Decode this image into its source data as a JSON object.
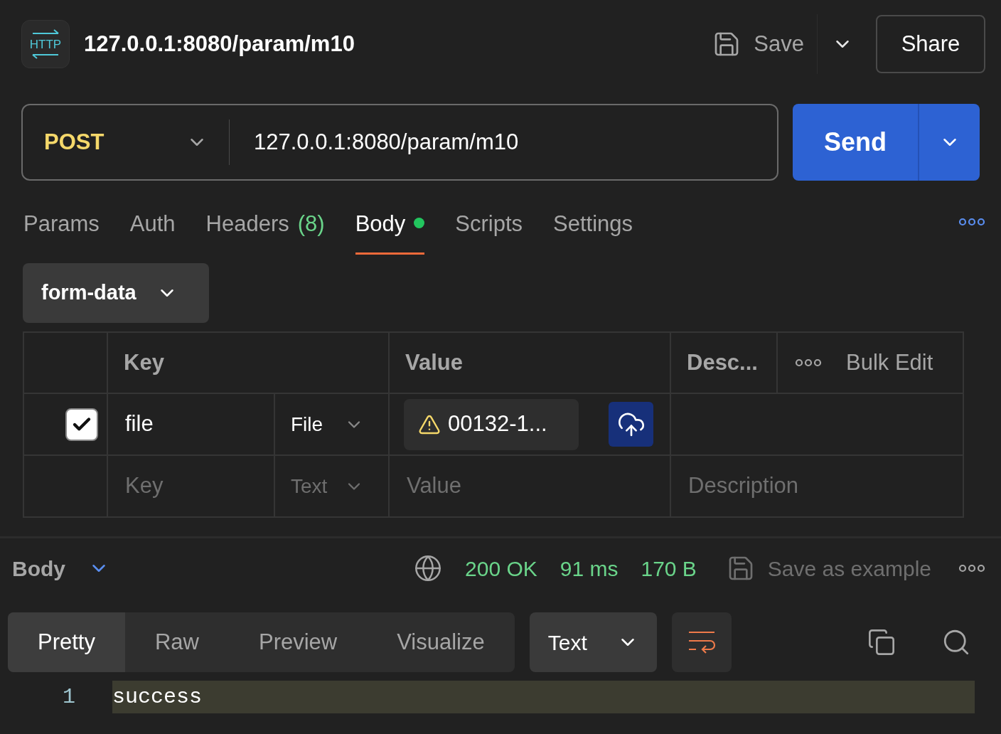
{
  "header": {
    "logo_text": "HTTP",
    "title": "127.0.0.1:8080/param/m10",
    "save_label": "Save",
    "share_label": "Share"
  },
  "request": {
    "method": "POST",
    "url": "127.0.0.1:8080/param/m10",
    "send_label": "Send"
  },
  "tabs": [
    {
      "label": "Params",
      "selected": false
    },
    {
      "label": "Auth",
      "selected": false
    },
    {
      "label": "Headers",
      "count": "(8)",
      "selected": false
    },
    {
      "label": "Body",
      "dot": true,
      "selected": true
    },
    {
      "label": "Scripts",
      "selected": false
    },
    {
      "label": "Settings",
      "selected": false
    }
  ],
  "body_mode": "form-data",
  "table": {
    "columns": [
      "Key",
      "Value",
      "Desc..."
    ],
    "bulk_edit": "Bulk Edit",
    "rows": [
      {
        "checked": true,
        "key": "file",
        "type": "File",
        "value": "00132-1..."
      }
    ],
    "new_row": {
      "key_placeholder": "Key",
      "type": "Text",
      "value_placeholder": "Value",
      "description_placeholder": "Description"
    }
  },
  "response": {
    "section": "Body",
    "status": "200 OK",
    "time": "91 ms",
    "size": "170 B",
    "save_example": "Save as example",
    "view_tabs": [
      {
        "label": "Pretty",
        "selected": true
      },
      {
        "label": "Raw",
        "selected": false
      },
      {
        "label": "Preview",
        "selected": false
      },
      {
        "label": "Visualize",
        "selected": false
      }
    ],
    "format": "Text",
    "lines": [
      {
        "number": "1",
        "text": "success"
      }
    ]
  }
}
